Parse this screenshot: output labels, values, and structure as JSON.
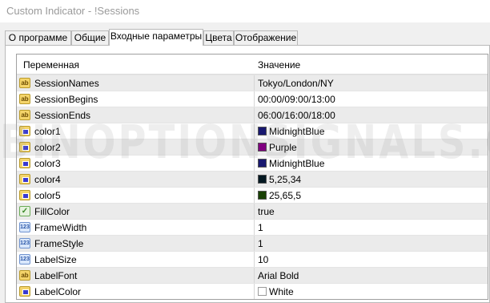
{
  "window": {
    "title": "Custom Indicator - !Sessions"
  },
  "tabs": [
    {
      "label": "О программе"
    },
    {
      "label": "Общие"
    },
    {
      "label": "Входные параметры"
    },
    {
      "label": "Цвета"
    },
    {
      "label": "Отображение"
    }
  ],
  "active_tab": "Входные параметры",
  "grid": {
    "header": {
      "variable": "Переменная",
      "value": "Значение"
    },
    "rows": [
      {
        "icon": "string-icon",
        "name": "SessionNames",
        "value": "Tokyo/London/NY"
      },
      {
        "icon": "string-icon",
        "name": "SessionBegins",
        "value": "00:00/09:00/13:00"
      },
      {
        "icon": "string-icon",
        "name": "SessionEnds",
        "value": "06:00/16:00/18:00"
      },
      {
        "icon": "color-icon",
        "name": "color1",
        "value": "MidnightBlue",
        "swatch": "#191970"
      },
      {
        "icon": "color-icon",
        "name": "color2",
        "value": "Purple",
        "swatch": "#800080"
      },
      {
        "icon": "color-icon",
        "name": "color3",
        "value": "MidnightBlue",
        "swatch": "#191970"
      },
      {
        "icon": "color-icon",
        "name": "color4",
        "value": "5,25,34",
        "swatch": "#051922"
      },
      {
        "icon": "color-icon",
        "name": "color5",
        "value": "25,65,5",
        "swatch": "#194105"
      },
      {
        "icon": "bool-icon",
        "name": "FillColor",
        "value": "true"
      },
      {
        "icon": "integer-icon",
        "name": "FrameWidth",
        "value": "1"
      },
      {
        "icon": "integer-icon",
        "name": "FrameStyle",
        "value": "1"
      },
      {
        "icon": "integer-icon",
        "name": "LabelSize",
        "value": "10"
      },
      {
        "icon": "string-icon",
        "name": "LabelFont",
        "value": "Arial Bold"
      },
      {
        "icon": "color-icon",
        "name": "LabelColor",
        "value": "White",
        "swatch": "#ffffff"
      }
    ]
  },
  "icon_glyphs": {
    "string": "ab",
    "integer": "123",
    "bool": "✓"
  },
  "watermark": "BINOPTIONSIGNALS.COM"
}
